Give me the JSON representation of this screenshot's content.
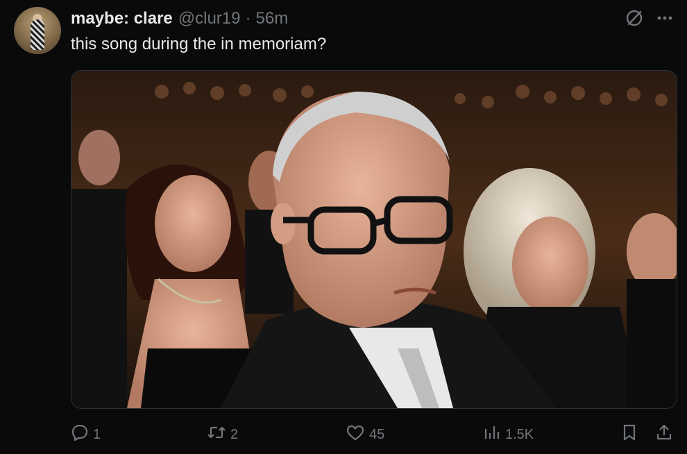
{
  "tweet": {
    "display_name": "maybe: clare",
    "handle": "@clur19",
    "separator": "·",
    "time": "56m",
    "text": "this song during the in memoriam?"
  },
  "actions": {
    "reply_count": "1",
    "retweet_count": "2",
    "like_count": "45",
    "views_count": "1.5K"
  },
  "icons": {
    "top_right": [
      "grok-icon",
      "more-icon"
    ],
    "actions": [
      "reply-icon",
      "retweet-icon",
      "like-icon",
      "views-icon",
      "bookmark-icon",
      "share-icon"
    ]
  },
  "colors": {
    "background": "#0a0a0a",
    "text_primary": "#e7e9ea",
    "text_secondary": "#71767b",
    "border": "#2f3336"
  }
}
